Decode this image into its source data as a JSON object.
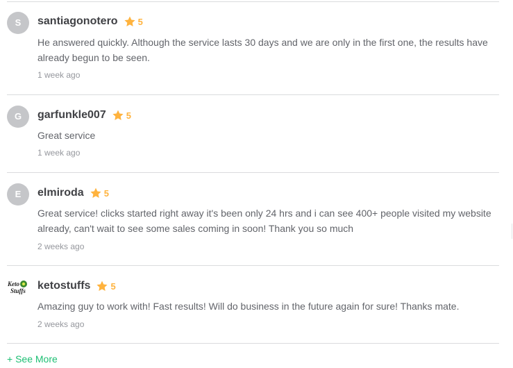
{
  "reviews": [
    {
      "initial": "S",
      "username": "santiagonotero",
      "rating": "5",
      "text": "He answered quickly. Although the service lasts 30 days and we are only in the first one, the results have already begun to be seen.",
      "time": "1 week ago"
    },
    {
      "initial": "G",
      "username": "garfunkle007",
      "rating": "5",
      "text": "Great service",
      "time": "1 week ago"
    },
    {
      "initial": "E",
      "username": "elmiroda",
      "rating": "5",
      "text": "Great service! clicks started right away it's been only 24 hrs and i can see 400+ people visited my website already, can't wait to see some sales coming in soon! Thank you so much",
      "time": "2 weeks ago"
    },
    {
      "logo_text": [
        "Keto",
        "Stuffs"
      ],
      "username": "ketostuffs",
      "rating": "5",
      "text": "Amazing guy to work with! Fast results! Will do business in the future again for sure! Thanks mate.",
      "time": "2 weeks ago"
    }
  ],
  "see_more": "+ See More",
  "colors": {
    "star": "#ffb33e",
    "link": "#1dbf73",
    "avatar": "#c5c6c9",
    "divider": "#dadbdd"
  },
  "icons": {
    "rating": "star-icon"
  }
}
